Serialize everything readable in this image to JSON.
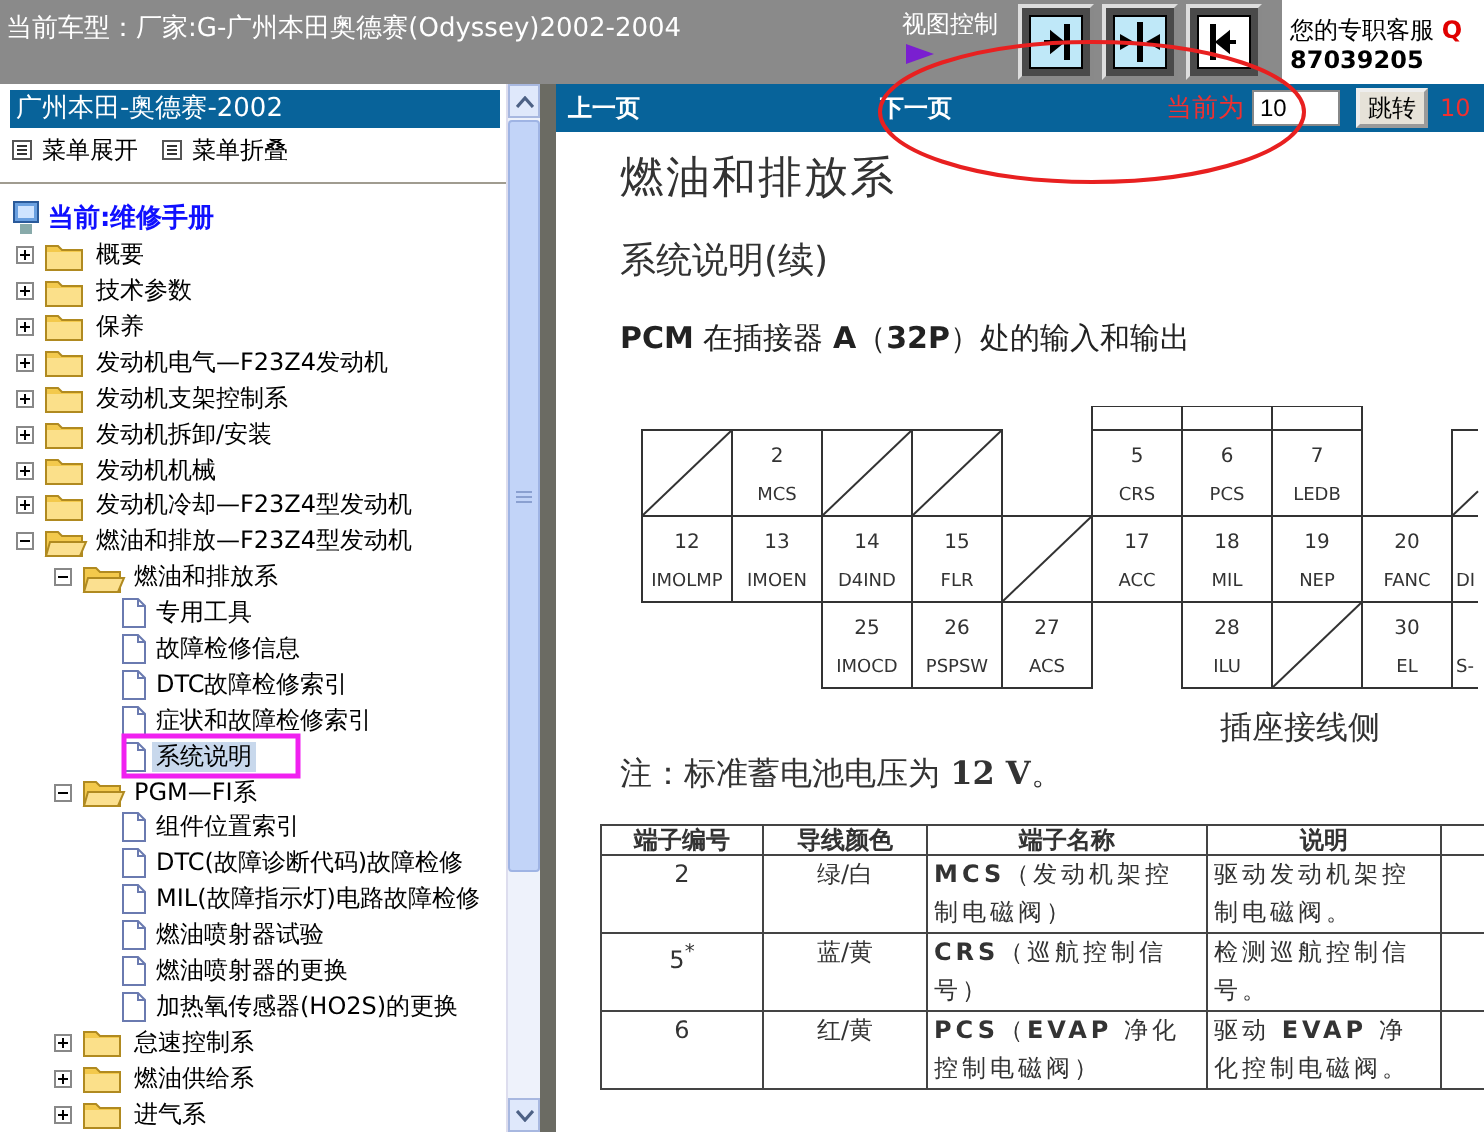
{
  "top_bar": {
    "title": "当前车型：厂家:G-广州本田奥德赛(Odyssey)2002-2004",
    "view_control_label": "视图控制",
    "view_buttons": [
      {
        "kind": "right"
      },
      {
        "kind": "inward"
      },
      {
        "kind": "left"
      }
    ],
    "service_label": "您的专职客服",
    "service_qq": "Q",
    "service_phone": "87039205"
  },
  "sidebar": {
    "header": "广州本田-奥德赛-2002",
    "expand_all": "菜单展开",
    "collapse_all": "菜单折叠",
    "root": "当前:维修手册",
    "tree": [
      {
        "label": "概要",
        "kind": "folder",
        "expanded": false,
        "selected": false
      },
      {
        "label": "技术参数",
        "kind": "folder",
        "expanded": false,
        "selected": false
      },
      {
        "label": "保养",
        "kind": "folder",
        "expanded": false,
        "selected": false
      },
      {
        "label": "发动机电气—F23Z4发动机",
        "kind": "folder",
        "expanded": false,
        "selected": false
      },
      {
        "label": "发动机支架控制系",
        "kind": "folder",
        "expanded": false,
        "selected": false
      },
      {
        "label": "发动机拆卸/安装",
        "kind": "folder",
        "expanded": false,
        "selected": false
      },
      {
        "label": "发动机机械",
        "kind": "folder",
        "expanded": false,
        "selected": false
      },
      {
        "label": "发动机冷却—F23Z4型发动机",
        "kind": "folder",
        "expanded": false,
        "selected": false
      },
      {
        "label": "燃油和排放—F23Z4型发动机",
        "kind": "folder",
        "expanded": true,
        "selected": false,
        "children": [
          {
            "label": "燃油和排放系",
            "kind": "folder",
            "expanded": true,
            "selected": false,
            "children": [
              {
                "label": "专用工具",
                "kind": "page",
                "selected": false
              },
              {
                "label": "故障检修信息",
                "kind": "page",
                "selected": false
              },
              {
                "label": "DTC故障检修索引",
                "kind": "page",
                "selected": false
              },
              {
                "label": "症状和故障检修索引",
                "kind": "page",
                "selected": false
              },
              {
                "label": "系统说明",
                "kind": "page",
                "selected": true
              }
            ]
          },
          {
            "label": "PGM—FI系",
            "kind": "folder",
            "expanded": true,
            "selected": false,
            "children": [
              {
                "label": "组件位置索引",
                "kind": "page",
                "selected": false
              },
              {
                "label": "DTC(故障诊断代码)故障检修",
                "kind": "page",
                "selected": false
              },
              {
                "label": "MIL(故障指示灯)电路故障检修",
                "kind": "page",
                "selected": false
              },
              {
                "label": "燃油喷射器试验",
                "kind": "page",
                "selected": false
              },
              {
                "label": "燃油喷射器的更换",
                "kind": "page",
                "selected": false
              },
              {
                "label": "加热氧传感器(HO2S)的更换",
                "kind": "page",
                "selected": false
              }
            ]
          },
          {
            "label": "怠速控制系",
            "kind": "folder",
            "expanded": false,
            "selected": false
          },
          {
            "label": "燃油供给系",
            "kind": "folder",
            "expanded": false,
            "selected": false
          },
          {
            "label": "进气系",
            "kind": "folder",
            "expanded": false,
            "selected": false
          }
        ]
      }
    ]
  },
  "nav_bar": {
    "prev": "上一页",
    "next": "下一页",
    "current_label": "当前为",
    "page_value": "10",
    "jump": "跳转",
    "total": "10"
  },
  "document": {
    "title": "燃油和排放系",
    "subtitle": "系统说明(续)",
    "section": "**PCM** 在插接器 **A**（**32P**）处的输入和输出",
    "connector": {
      "rows": [
        [
          {
            "kind": "blank"
          },
          {
            "kind": "pin",
            "number": "2",
            "name": "MCS"
          },
          {
            "kind": "blank"
          },
          {
            "kind": "blank"
          },
          {
            "kind": "gap"
          },
          {
            "kind": "pin",
            "number": "5",
            "name": "CRS",
            "shroud": true
          },
          {
            "kind": "pin",
            "number": "6",
            "name": "PCS",
            "shroud": true
          },
          {
            "kind": "pin",
            "number": "7",
            "name": "LEDB",
            "shroud": true
          },
          {
            "kind": "gap"
          },
          {
            "kind": "blank"
          }
        ],
        [
          {
            "kind": "pin",
            "number": "12",
            "name": "IMOLMP"
          },
          {
            "kind": "pin",
            "number": "13",
            "name": "IMOEN"
          },
          {
            "kind": "pin",
            "number": "14",
            "name": "D4IND"
          },
          {
            "kind": "pin",
            "number": "15",
            "name": "FLR"
          },
          {
            "kind": "blank"
          },
          {
            "kind": "pin",
            "number": "17",
            "name": "ACC"
          },
          {
            "kind": "pin",
            "number": "18",
            "name": "MIL"
          },
          {
            "kind": "pin",
            "number": "19",
            "name": "NEP"
          },
          {
            "kind": "pin",
            "number": "20",
            "name": "FANC"
          },
          {
            "kind": "pin",
            "name": "DI"
          }
        ],
        [
          {
            "kind": "gap"
          },
          {
            "kind": "gap"
          },
          {
            "kind": "pin",
            "number": "25",
            "name": "IMOCD"
          },
          {
            "kind": "pin",
            "number": "26",
            "name": "PSPSW"
          },
          {
            "kind": "pin",
            "number": "27",
            "name": "ACS"
          },
          {
            "kind": "gap"
          },
          {
            "kind": "pin",
            "number": "28",
            "name": "ILU"
          },
          {
            "kind": "blank"
          },
          {
            "kind": "pin",
            "number": "30",
            "name": "EL"
          },
          {
            "kind": "pin",
            "name": "S-"
          }
        ]
      ],
      "caption": "插座接线侧"
    },
    "note": "注：标准蓄电池电压为 **12 V**。",
    "table": {
      "columns": [
        "端子编号",
        "导线颜色",
        "端子名称",
        "说明"
      ],
      "rows": [
        [
          "2",
          "绿/白",
          "**MCS**（发动机架控制电磁阀）",
          "驱动发动机架控制电磁阀。"
        ],
        [
          "5$^{*}$",
          "蓝/黄",
          "**CRS**（巡航控制信号）",
          "检测巡航控制信号。"
        ],
        [
          "6",
          "红/黄",
          "**PCS**（**EVAP** 净化控制电磁阀）",
          "驱动 **EVAP** 净化控制电磁阀。"
        ]
      ]
    }
  },
  "annotations": [
    {
      "kind": "ellipse"
    },
    {
      "kind": "rectangle"
    }
  ]
}
